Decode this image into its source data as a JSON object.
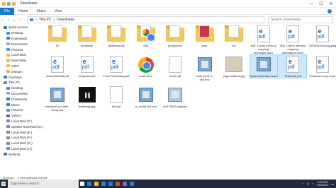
{
  "window": {
    "title": "Downloads",
    "controls": [
      "—",
      "☐",
      "✕"
    ]
  },
  "ribbon": {
    "tabs": [
      "File",
      "Home",
      "Share",
      "View"
    ],
    "help": "?"
  },
  "address": {
    "crumbs": [
      "This PC",
      "Downloads"
    ],
    "search_placeholder": "Search Downloads"
  },
  "sidebar": {
    "items": [
      {
        "label": "Quick access",
        "icon": "star-icon",
        "color": "#2b7ad6",
        "indent": false
      },
      {
        "label": "Desktop",
        "icon": "desktop-icon",
        "color": "#3b8fd9",
        "indent": true
      },
      {
        "label": "Downloads",
        "icon": "download-icon",
        "color": "#2b7ad6",
        "indent": true
      },
      {
        "label": "Documents",
        "icon": "documents-icon",
        "color": "#9aa8b8",
        "indent": true
      },
      {
        "label": "Pictures",
        "icon": "pictures-icon",
        "color": "#4a9be0",
        "indent": true
      },
      {
        "label": "Local Disk",
        "icon": "folder-icon",
        "color": "#e9b949",
        "indent": true
      },
      {
        "label": "New folder",
        "icon": "folder-icon",
        "color": "#e9b949",
        "indent": true
      },
      {
        "label": "Other",
        "icon": "folder-icon",
        "color": "#e9b949",
        "indent": true
      },
      {
        "label": "testcam",
        "icon": "folder-icon",
        "color": "#e9b949",
        "indent": true
      },
      {
        "label": "OneDrive",
        "icon": "cloud-icon",
        "color": "#2b7ad6",
        "indent": false
      },
      {
        "label": "This PC",
        "icon": "pc-icon",
        "color": "#3b8fd9",
        "indent": false
      },
      {
        "label": "Desktop",
        "icon": "desktop-icon",
        "color": "#3b8fd9",
        "indent": true
      },
      {
        "label": "Documents",
        "icon": "documents-icon",
        "color": "#9aa8b8",
        "indent": true
      },
      {
        "label": "Downloads",
        "icon": "download-icon",
        "color": "#2b7ad6",
        "indent": true
      },
      {
        "label": "Music",
        "icon": "music-icon",
        "color": "#2b7ad6",
        "indent": true
      },
      {
        "label": "Pictures",
        "icon": "pictures-icon",
        "color": "#4a9be0",
        "indent": true
      },
      {
        "label": "Videos",
        "icon": "videos-icon",
        "color": "#4a6fb0",
        "indent": true
      },
      {
        "label": "Local Disk (C:)",
        "icon": "disk-icon",
        "color": "#7a8aa0",
        "indent": true
      },
      {
        "label": "System Reserved (D:)",
        "icon": "disk-icon",
        "color": "#7a8aa0",
        "indent": true
      },
      {
        "label": "Local Disk (E:)",
        "icon": "disk-icon",
        "color": "#7a8aa0",
        "indent": true
      },
      {
        "label": "Local Disk (F:)",
        "icon": "disk-icon",
        "color": "#7a8aa0",
        "indent": true
      },
      {
        "label": "Local Disk (G:)",
        "icon": "disk-icon",
        "color": "#7a8aa0",
        "indent": true
      },
      {
        "label": "Local Disk (H:)",
        "icon": "disk-icon",
        "color": "#7a8aa0",
        "indent": true
      },
      {
        "label": "Network",
        "icon": "network-icon",
        "color": "#2b7ad6",
        "indent": false
      }
    ]
  },
  "files": [
    {
      "name": "bt",
      "type": "folder"
    },
    {
      "name": "bootstrap",
      "type": "folder"
    },
    {
      "name": "cybersecurity",
      "type": "folder"
    },
    {
      "name": "dist",
      "type": "folder-chrome"
    },
    {
      "name": "phpopencv",
      "type": "folder"
    },
    {
      "name": "prac",
      "type": "folder-app"
    },
    {
      "name": "sw",
      "type": "folder"
    },
    {
      "name": "3(d). Cache memory mapping technique.docx",
      "type": "pdf"
    },
    {
      "name": "3(e). Cache memory mapping calculations.docx",
      "type": "pdf"
    },
    {
      "name": "2041551448.png.jpeg",
      "type": "pdf"
    },
    {
      "name": "Ardeni Ahmad.pdf",
      "type": "pdf"
    },
    {
      "name": "composer.pdf",
      "type": "pdf"
    },
    {
      "name": "Form Processing.pdf",
      "type": "pdf"
    },
    {
      "name": "index.html",
      "type": "chrome"
    },
    {
      "name": "movie.gif",
      "type": "blank"
    },
    {
      "name": "node-v8.11.1-x64.msi",
      "type": "installer"
    },
    {
      "name": "page-outlined.jpg",
      "type": "image"
    },
    {
      "name": "SystemInterface.foundation.exe",
      "type": "installer",
      "selected": true
    },
    {
      "name": "Tesseract.pdf",
      "type": "pdf",
      "selected": true
    },
    {
      "name": "Tesseract-copy-1.pdf",
      "type": "pdf"
    },
    {
      "name": "tesseract-ocr-w64-setup.exe",
      "type": "installer"
    },
    {
      "name": "testimage.jpg",
      "type": "qr"
    },
    {
      "name": "test.gif",
      "type": "blank"
    },
    {
      "name": "vc_redist.x64.exe",
      "type": "installer"
    },
    {
      "name": "wu170509.diagcab",
      "type": "cab"
    }
  ],
  "status": {
    "count": "25 items",
    "selection": "1 item selected  316 KB"
  },
  "taskbar": {
    "search_text": "Type here to search",
    "apps": [
      {
        "icon": "task-view-icon",
        "color": "#ffffff"
      },
      {
        "icon": "edge-icon",
        "color": "#2b7ad6"
      },
      {
        "icon": "file-explorer-icon",
        "color": "#e9b949"
      },
      {
        "icon": "store-icon",
        "color": "#2b7ad6"
      },
      {
        "icon": "mail-icon",
        "color": "#2b7ad6"
      },
      {
        "icon": "chrome-icon",
        "color": "#db4437"
      },
      {
        "icon": "visual-studio-icon",
        "color": "#865fc5"
      },
      {
        "icon": "photos-icon",
        "color": "#2b7ad6"
      }
    ],
    "time": "1:19 PM",
    "date": "7/10/2017"
  }
}
